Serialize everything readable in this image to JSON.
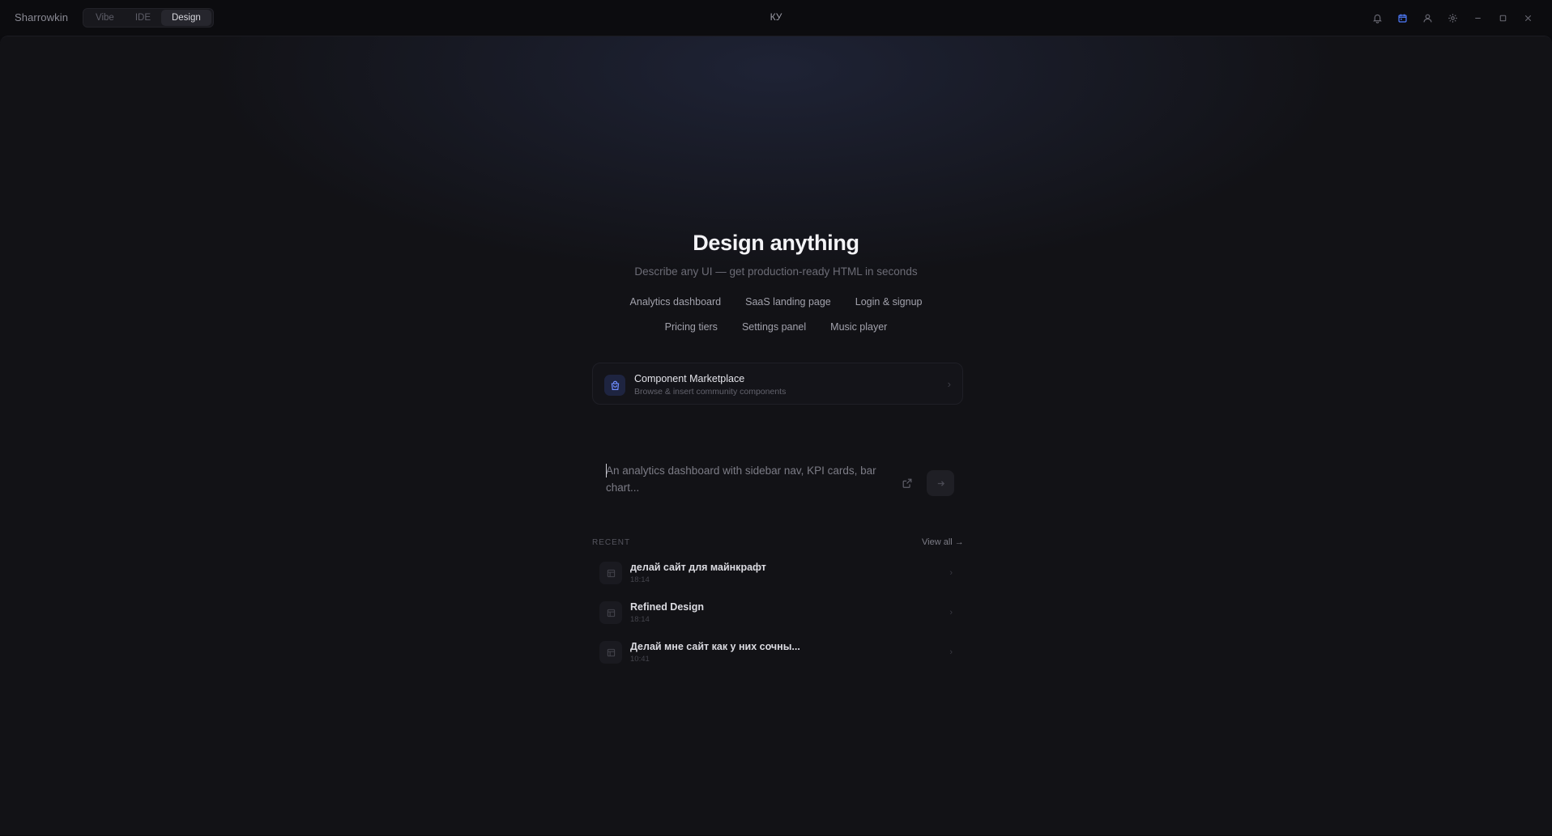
{
  "app": {
    "name": "Sharrowkin",
    "window_title": "КУ"
  },
  "mode_tabs": [
    {
      "label": "Vibe",
      "active": false
    },
    {
      "label": "IDE",
      "active": false
    },
    {
      "label": "Design",
      "active": true
    }
  ],
  "toolbar_icons": [
    "bell-icon",
    "calendar-icon",
    "user-icon",
    "gear-icon"
  ],
  "window_controls": [
    "minimize-icon",
    "maximize-icon",
    "close-icon"
  ],
  "hero": {
    "title": "Design anything",
    "subtitle": "Describe any UI — get production-ready HTML in seconds"
  },
  "suggestions": {
    "row1": [
      "Analytics dashboard",
      "SaaS landing page",
      "Login & signup"
    ],
    "row2": [
      "Pricing tiers",
      "Settings panel",
      "Music player"
    ]
  },
  "marketplace": {
    "title": "Component Marketplace",
    "subtitle": "Browse & insert community components",
    "icon": "shopping-bag-icon"
  },
  "prompt": {
    "placeholder": "An analytics dashboard with sidebar nav, KPI cards, bar chart..."
  },
  "recent": {
    "label": "RECENT",
    "view_all": "View all →",
    "items": [
      {
        "title": "делай сайт для майнкрафт",
        "time": "18:14"
      },
      {
        "title": "Refined Design",
        "time": "18:14"
      },
      {
        "title": "Делай мне сайт как у них сочны...",
        "time": "10:41"
      }
    ]
  },
  "colors": {
    "accent": "#4f7cff",
    "background": "#121216",
    "titlebar": "#0c0c0f"
  }
}
